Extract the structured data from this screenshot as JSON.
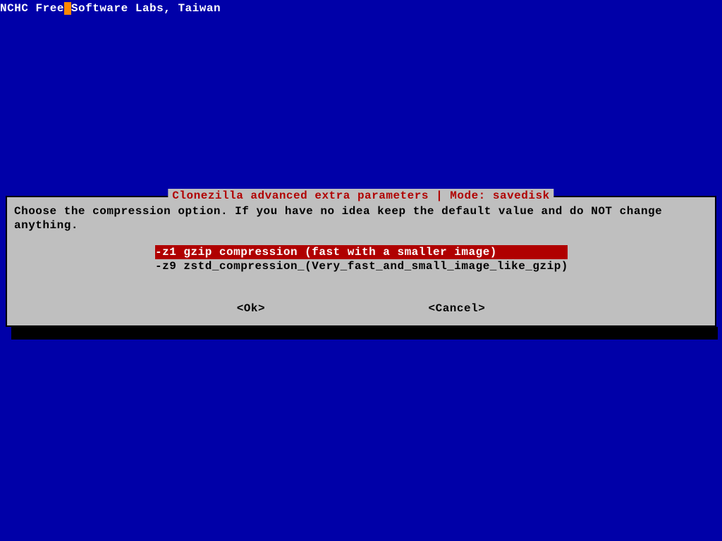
{
  "header": {
    "text_before": "NCHC Free",
    "text_after": "Software Labs, Taiwan"
  },
  "dialog": {
    "title": "Clonezilla advanced extra parameters | Mode: savedisk",
    "message": "Choose the compression option. If you have no idea keep the default value and do NOT change\nanything.",
    "options": [
      {
        "flag": "-z1",
        "label": "gzip compression (fast with a smaller image)",
        "selected": true
      },
      {
        "flag": "-z9",
        "label": "zstd_compression_(Very_fast_and_small_image_like_gzip)",
        "selected": false
      }
    ],
    "ok_label": "<Ok>",
    "cancel_label": "<Cancel>"
  }
}
